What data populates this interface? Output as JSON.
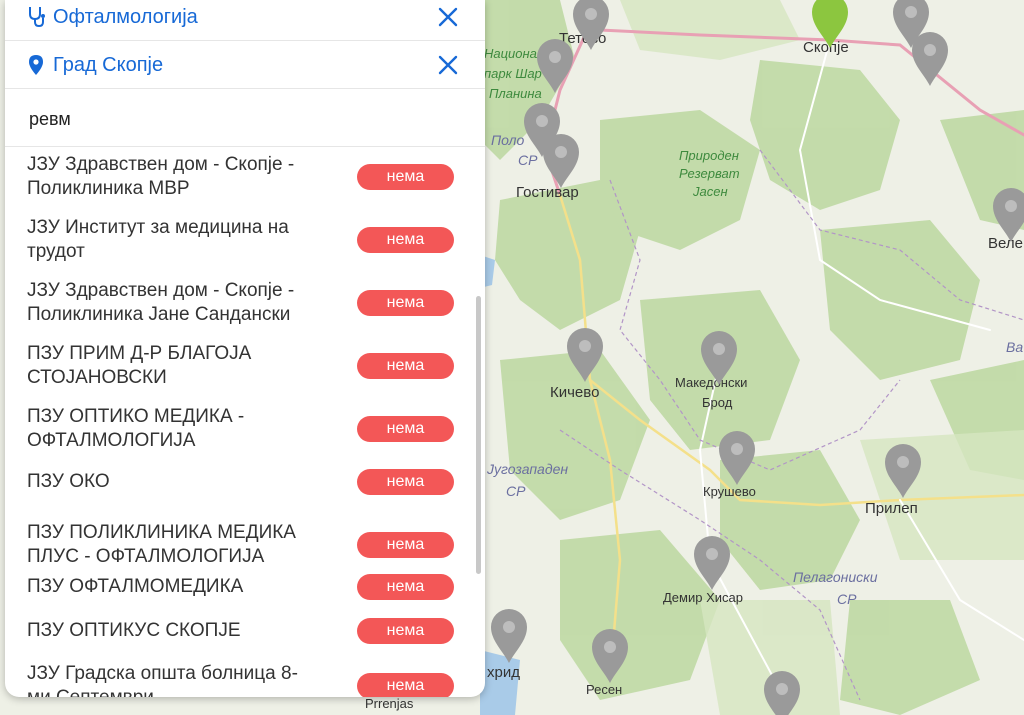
{
  "filters": {
    "specialty": "Офталмологија",
    "city": "Град Скопје"
  },
  "search": {
    "value": "ревм"
  },
  "results": [
    {
      "line1": "ЈЗУ Здравствен дом - Скопје -",
      "line2": "Поликлиника МВР",
      "status": "нема"
    },
    {
      "line1": "ЈЗУ Институт за медицина на",
      "line2": "трудот",
      "status": "нема"
    },
    {
      "line1": "ЈЗУ Здравствен дом - Скопје -",
      "line2": "Поликлиника Јане Сандански",
      "status": "нема"
    },
    {
      "line1": "ПЗУ ПРИМ Д-Р БЛАГОЈА",
      "line2": "СТОЈАНОВСКИ",
      "status": "нема"
    },
    {
      "line1": "ПЗУ ОПТИКО МЕДИКА -",
      "line2": "ОФТАЛМОЛОГИЈА",
      "status": "нема"
    },
    {
      "line1": "ПЗУ ОКО",
      "line2": "",
      "status": "нема"
    },
    {
      "line1": "ПЗУ ПОЛИКЛИНИКА МЕДИКА",
      "line2": "ПЛУС - ОФТАЛМОЛОГИЈА",
      "status": "нема"
    },
    {
      "line1": "ПЗУ ОФТАЛМОМЕДИКА",
      "line2": "",
      "status": "нема"
    },
    {
      "line1": "ПЗУ ОПТИКУС СКОПЈЕ",
      "line2": "",
      "status": "нема"
    },
    {
      "line1": "ЈЗУ Градска општа болница 8-",
      "line2": "ми Септември",
      "status": "нема"
    }
  ],
  "map": {
    "cities": {
      "tetovo": "Тетово",
      "skopje": "Скопје",
      "gostivar": "Гостивар",
      "kichevo": "Кичево",
      "makedonski_brod_1": "Македонски",
      "makedonski_brod_2": "Брод",
      "krushevo": "Крушево",
      "prilep": "Прилеп",
      "demir_hisar": "Демир Хисар",
      "resen": "Ресен",
      "ohrid": "хрид",
      "veles": "Веле",
      "prrenjas": "Prrenjas"
    },
    "regions": {
      "polog_1": "Поло",
      "polog_2": "СР",
      "jugozapaden_1": "Југозападен",
      "jugozapaden_2": "СР",
      "pelagoniski_1": "Пелагониски",
      "pelagoniski_2": "СР",
      "vardar": "Ва"
    },
    "parks": {
      "shar_1": "Национален",
      "shar_2": "парк Шар",
      "shar_3": "Планина",
      "jasen_1": "Природен",
      "jasen_2": "Резерват",
      "jasen_3": "Јасен"
    },
    "colors": {
      "marker_default": "#9a9a9a",
      "marker_selected": "#8cc63f",
      "accent": "#1769d6",
      "badge": "#f35757"
    }
  }
}
